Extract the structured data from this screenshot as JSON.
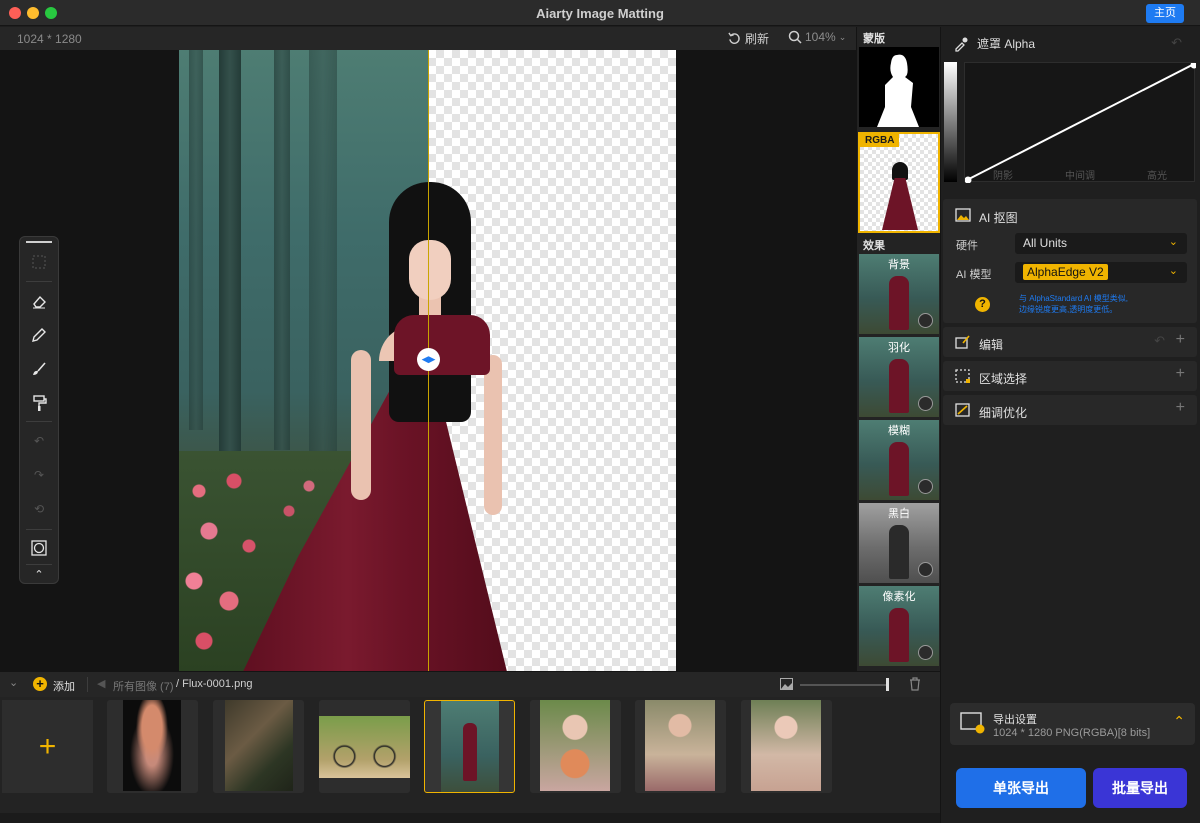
{
  "window": {
    "title": "Aiarty Image Matting",
    "home_label": "主页"
  },
  "canvas": {
    "dimensions": "1024 * 1280",
    "refresh_label": "刷新",
    "zoom": "104%"
  },
  "strip": {
    "mask_label": "蒙版",
    "rgba_label": "RGBA",
    "effects_label": "效果",
    "effects": [
      {
        "name": "背景"
      },
      {
        "name": "羽化"
      },
      {
        "name": "模糊"
      },
      {
        "name": "黑白"
      },
      {
        "name": "像素化"
      }
    ]
  },
  "panel": {
    "alpha_title": "遮罩 Alpha",
    "curve_labels": [
      "阴影",
      "中间调",
      "高光"
    ],
    "ai_section": {
      "title": "AI 抠图",
      "hardware_label": "硬件",
      "hardware_value": "All Units",
      "model_label": "AI 模型",
      "model_value": "AlphaEdge  V2",
      "hint_line1": "与 AlphaStandard AI 模型类似,",
      "hint_line2": "边缘锐度更高,透明度更低。"
    },
    "edit_title": "编辑",
    "region_title": "区域选择",
    "refine_title": "细调优化",
    "export": {
      "title": "导出设置",
      "subtitle": "1024 * 1280 PNG(RGBA)[8 bits]",
      "single_label": "单张导出",
      "batch_label": "批量导出"
    }
  },
  "filmstrip": {
    "add_label": "添加",
    "breadcrumb_all": "所有图像 (7)",
    "breadcrumb_file": "/ Flux-0001.png",
    "thumbs": [
      {
        "name": "jellyfish"
      },
      {
        "name": "forest-floor"
      },
      {
        "name": "bicycle"
      },
      {
        "name": "woman-red-dress"
      },
      {
        "name": "woman-flowers-1"
      },
      {
        "name": "woman-flowers-2"
      },
      {
        "name": "woman-flowers-3"
      }
    ]
  },
  "colors": {
    "accent": "#f0b400",
    "primary_blue": "#1e7bf2",
    "batch_purple": "#3a35d6"
  }
}
